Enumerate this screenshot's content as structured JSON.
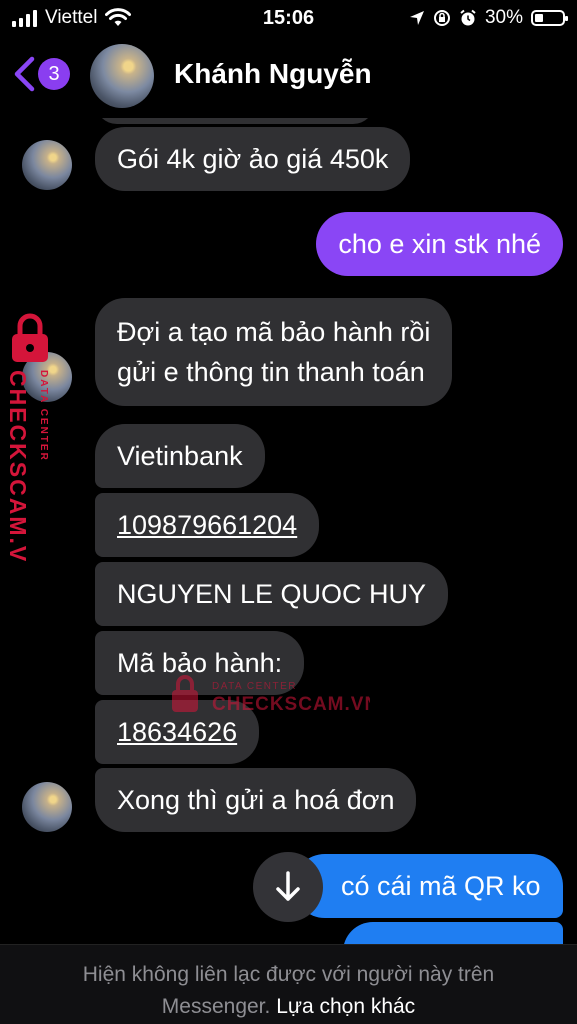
{
  "status_bar": {
    "carrier": "Viettel",
    "time": "15:06",
    "battery_percent": "30%",
    "battery_level": 0.3
  },
  "header": {
    "back_badge": "3",
    "contact_name": "Khánh Nguyễn"
  },
  "messages": [
    {
      "from": "contact",
      "text": "Gói 4k giờ ảo giá 450k"
    },
    {
      "from": "me",
      "text": "cho e xin stk nhé"
    },
    {
      "from": "contact",
      "lines": [
        "Đợi a tạo mã bảo hành rồi",
        "gửi e thông tin thanh toán"
      ]
    },
    {
      "from": "contact",
      "text": "Vietinbank"
    },
    {
      "from": "contact",
      "text": "109879661204",
      "link": true
    },
    {
      "from": "contact",
      "text": "NGUYEN LE QUOC HUY"
    },
    {
      "from": "contact",
      "text": "Mã bảo hành:"
    },
    {
      "from": "contact",
      "text": "18634626",
      "link": true
    },
    {
      "from": "contact",
      "text": "Xong thì gửi a hoá đơn"
    },
    {
      "from": "me",
      "text": "có cái mã QR ko"
    }
  ],
  "watermark": {
    "brand": "CHECKSCAM.VN",
    "sub": "DATA CENTER"
  },
  "footer": {
    "notice_line1": "Hiện không liên lạc được với người này trên",
    "notice_line2": "Messenger.",
    "other_options": "Lựa chọn khác"
  },
  "colors": {
    "background": "#000000",
    "incoming_bubble": "#303033",
    "outgoing_purple": "#8a46f5",
    "outgoing_blue": "#1f7ef2",
    "badge": "#8a3ef0",
    "watermark": "#d4153a"
  }
}
